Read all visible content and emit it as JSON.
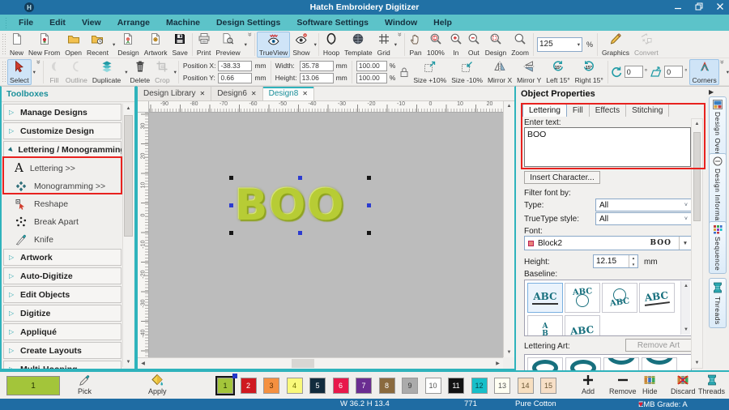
{
  "colors": {
    "titlebar": "#2171a5",
    "menubar": "#5cc3c9",
    "accent_teal": "#2fb3bc",
    "annotation_red": "#e8221f",
    "canvas_gray": "#bcbcbc",
    "active_bg": "#cfe4f7",
    "design_fill": "#b7cc35",
    "statusbar": "#1f6ca3"
  },
  "title_bar": {
    "title": "Hatch Embroidery Digitizer"
  },
  "menu_bar": {
    "items": [
      "File",
      "Edit",
      "View",
      "Arrange",
      "Machine",
      "Design Settings",
      "Software Settings",
      "Window",
      "Help"
    ]
  },
  "toolbar_main": {
    "groups": [
      {
        "buttons": [
          {
            "label": "New",
            "icon": "page"
          },
          {
            "label": "New From",
            "icon": "pageplus"
          },
          {
            "label": "Open",
            "icon": "folder"
          },
          {
            "label": "Recent",
            "icon": "folderclock",
            "menu": true
          },
          {
            "label": "Design",
            "icon": "pageflower"
          },
          {
            "label": "Artwork",
            "icon": "pageart"
          },
          {
            "label": "Save",
            "icon": "floppy"
          }
        ]
      },
      {
        "overflow": true,
        "buttons": [
          {
            "label": "Print",
            "icon": "printer"
          },
          {
            "label": "Preview",
            "icon": "preview",
            "menu": true
          }
        ]
      },
      {
        "buttons": [
          {
            "label": "TrueView",
            "icon": "trueview",
            "active": true
          },
          {
            "label": "Show",
            "icon": "show",
            "menu": true
          }
        ]
      },
      {
        "overflow": true,
        "buttons": [
          {
            "label": "Hoop",
            "icon": "hoop"
          },
          {
            "label": "Template",
            "icon": "template"
          },
          {
            "label": "Grid",
            "icon": "grid",
            "menu": true
          }
        ]
      },
      {
        "buttons": [
          {
            "label": "Pan",
            "icon": "pan"
          },
          {
            "label": "100%",
            "icon": "mag100"
          },
          {
            "label": "In",
            "icon": "magin"
          },
          {
            "label": "Out",
            "icon": "magout"
          },
          {
            "label": "Design",
            "icon": "magdesign"
          },
          {
            "label": "Zoom",
            "icon": "mag"
          }
        ]
      },
      {
        "zoom_combo": {
          "value": "125",
          "unit": "%"
        }
      },
      {
        "buttons": [
          {
            "label": "Graphics",
            "icon": "pencil"
          },
          {
            "label": "Convert",
            "icon": "convert",
            "disabled": true
          }
        ]
      }
    ]
  },
  "toolbar_edit": {
    "select": {
      "label": "Select",
      "icon": "select",
      "active": true
    },
    "buttons": [
      {
        "label": "Fill",
        "icon": "fillshape",
        "disabled": true
      },
      {
        "label": "Outline",
        "icon": "outlineshape",
        "disabled": true
      },
      {
        "label": "Duplicate",
        "icon": "duplicate",
        "menu": true
      },
      {
        "label": "Delete",
        "icon": "trash"
      },
      {
        "label": "Crop",
        "icon": "crop",
        "disabled": true,
        "menu": true
      }
    ],
    "position_x_label": "Position X:",
    "position_x": "-38.33",
    "position_y_label": "Position Y:",
    "position_y": "0.66",
    "width_label": "Width:",
    "width": "35.78",
    "height_label": "Height:",
    "height": "13.06",
    "scale_x": "100.00",
    "scale_y": "100.00",
    "unit_mm": "mm",
    "unit_pct": "%",
    "size_buttons": [
      {
        "label": "Size +10%",
        "icon": "sizeplus"
      },
      {
        "label": "Size -10%",
        "icon": "sizeminus"
      },
      {
        "label": "Mirror X",
        "icon": "mirrorx"
      },
      {
        "label": "Mirror Y",
        "icon": "mirrory"
      },
      {
        "label": "Left 15°",
        "icon": "left15"
      },
      {
        "label": "Right 15°",
        "icon": "right15"
      }
    ],
    "rotate_value": "0",
    "skew_value": "0",
    "degree": "°",
    "corners": {
      "label": "Corners",
      "icon": "corners",
      "active": true
    }
  },
  "toolboxes": {
    "header": "Toolboxes",
    "sections": [
      {
        "label": "Manage Designs",
        "expanded": false
      },
      {
        "label": "Customize Design",
        "expanded": false
      },
      {
        "label": "Lettering / Monogramming",
        "expanded": true,
        "annotated": true,
        "tools": [
          {
            "label": "Lettering >>",
            "icon": "lettering"
          },
          {
            "label": "Monogramming >>",
            "icon": "monogram"
          },
          {
            "label": "Reshape",
            "icon": "reshape"
          },
          {
            "label": "Break Apart",
            "icon": "breakapart"
          },
          {
            "label": "Knife",
            "icon": "knife"
          }
        ]
      },
      {
        "label": "Artwork",
        "expanded": false
      },
      {
        "label": "Auto-Digitize",
        "expanded": false
      },
      {
        "label": "Edit Objects",
        "expanded": false
      },
      {
        "label": "Digitize",
        "expanded": false
      },
      {
        "label": "Appliqué",
        "expanded": false
      },
      {
        "label": "Create Layouts",
        "expanded": false
      },
      {
        "label": "Multi-Hooping",
        "expanded": false
      }
    ]
  },
  "canvas": {
    "tabs": [
      {
        "label": "Design Library"
      },
      {
        "label": "Design6"
      },
      {
        "label": "Design8",
        "active": true
      }
    ],
    "design_text": "BOO",
    "h_ruler": [
      "-90",
      "-80",
      "-70",
      "-60",
      "-50",
      "-40",
      "-30",
      "-20",
      "-10",
      "0",
      "10",
      "20"
    ],
    "v_ruler": [
      "30",
      "20",
      "10",
      "0",
      "-10",
      "-20",
      "-30",
      "-40"
    ]
  },
  "object_properties": {
    "title": "Object Properties",
    "tabs": [
      {
        "label": "Lettering",
        "active": true
      },
      {
        "label": "Fill"
      },
      {
        "label": "Effects"
      },
      {
        "label": "Stitching"
      }
    ],
    "enter_text_label": "Enter text:",
    "text_value": "BOO",
    "insert_character_label": "Insert Character...",
    "filter_label": "Filter font by:",
    "type_label": "Type:",
    "type_value": "All",
    "truetype_label": "TrueType style:",
    "truetype_value": "All",
    "font_label": "Font:",
    "font_name": "Block2",
    "font_preview": "BOO",
    "height_label": "Height:",
    "height_value": "12.15",
    "height_unit": "mm",
    "baseline_label": "Baseline:",
    "baseline_options": [
      "straight",
      "arc-over-circle",
      "circle-over-arc",
      "slanted",
      "vertical",
      "arched"
    ],
    "lettering_art_label": "Lettering Art:",
    "remove_art_label": "Remove Art"
  },
  "side_tabs": [
    {
      "label": "Design Overview",
      "icon": "tabov"
    },
    {
      "label": "Design Information",
      "icon": "tabinfo"
    },
    {
      "label": "Sequence",
      "icon": "tabseq"
    },
    {
      "label": "Threads",
      "icon": "spool"
    }
  ],
  "palette": {
    "current_number": "1",
    "pick_label": "Pick",
    "apply_label": "Apply",
    "selected": 0,
    "swatches": [
      {
        "n": "1",
        "c": "#a3c53a",
        "t": "#243300"
      },
      {
        "n": "2",
        "c": "#cf1920",
        "t": "#ffffff"
      },
      {
        "n": "3",
        "c": "#f49040",
        "t": "#5a2d00"
      },
      {
        "n": "4",
        "c": "#f9f97a",
        "t": "#6a6a00"
      },
      {
        "n": "5",
        "c": "#122c3e",
        "t": "#ffffff"
      },
      {
        "n": "6",
        "c": "#e8194b",
        "t": "#ffffff"
      },
      {
        "n": "7",
        "c": "#6a2d91",
        "t": "#ffffff"
      },
      {
        "n": "8",
        "c": "#8a6a3e",
        "t": "#ffffff"
      },
      {
        "n": "9",
        "c": "#ababab",
        "t": "#333333"
      },
      {
        "n": "10",
        "c": "#ffffff",
        "t": "#555555"
      },
      {
        "n": "11",
        "c": "#121212",
        "t": "#ffffff"
      },
      {
        "n": "12",
        "c": "#16bfc9",
        "t": "#06454a"
      },
      {
        "n": "13",
        "c": "#fffff2",
        "t": "#555555"
      },
      {
        "n": "14",
        "c": "#f7dfc0",
        "t": "#6a5533"
      },
      {
        "n": "15",
        "c": "#f7dfc7",
        "t": "#6a5533"
      }
    ]
  },
  "thread_actions": [
    {
      "label": "Add",
      "icon": "plus"
    },
    {
      "label": "Remove",
      "icon": "minus"
    },
    {
      "label": "Hide",
      "icon": "spools"
    },
    {
      "label": "Discard",
      "icon": "spoolsx"
    },
    {
      "label": "Threads",
      "icon": "spool"
    }
  ],
  "status_bar": {
    "dimensions": "W  36.2 H  13.4",
    "stitch_count": "771",
    "fabric": "Pure Cotton",
    "grade": "EMB Grade: A"
  }
}
